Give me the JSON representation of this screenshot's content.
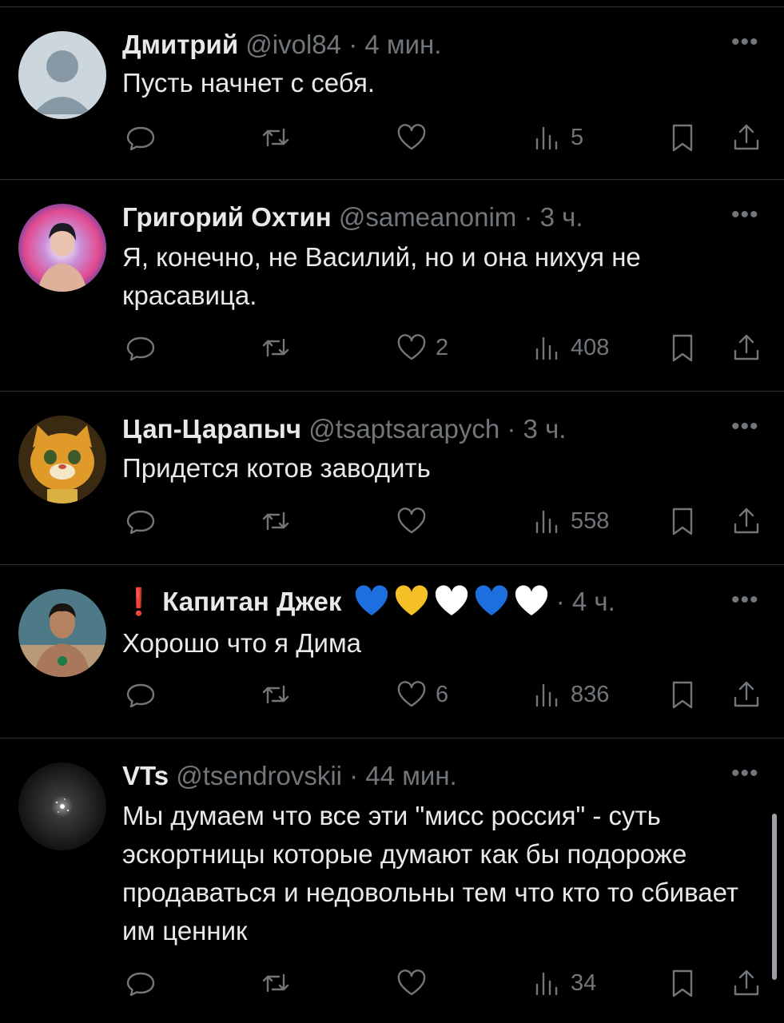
{
  "posts": [
    {
      "name": "Дмитрий",
      "handle": "@ivol84",
      "time": "4 мин.",
      "text": "Пусть начнет с себя.",
      "likes": "",
      "views": "5"
    },
    {
      "name": "Григорий Охтин",
      "handle": "@sameanonim",
      "time": "3 ч.",
      "text": "Я, конечно, не Василий, но и она нихуя не красавица.",
      "likes": "2",
      "views": "408"
    },
    {
      "name": "Цап-Царапыч",
      "handle": "@tsaptsarapych",
      "time": "3 ч.",
      "text": "Придется котов заводить",
      "likes": "",
      "views": "558"
    },
    {
      "name": "Капитан Джек",
      "name_prefix": "❗",
      "handle": "",
      "time": "4 ч.",
      "text": "Хорошо что я Дима",
      "likes": "6",
      "views": "836",
      "heart_colors": [
        "#1d6fe0",
        "#f5c026",
        "#ffffff",
        "#1d6fe0",
        "#ffffff"
      ]
    },
    {
      "name": "VTs",
      "handle": "@tsendrovskii",
      "time": "44 мин.",
      "text": "Мы думаем что все эти \"мисс россия\" - суть эскортницы которые думают как бы подороже продаваться и недовольны тем что кто то сбивает им ценник",
      "likes": "",
      "views": "34"
    }
  ],
  "separator": "·",
  "more_label": "•••",
  "icons": [
    "reply-icon",
    "retweet-icon",
    "like-icon",
    "views-icon",
    "bookmark-icon",
    "share-icon"
  ],
  "colors": {
    "background": "#000000",
    "text": "#e7e9ea",
    "muted": "#71767b",
    "divider": "#2f3336"
  }
}
